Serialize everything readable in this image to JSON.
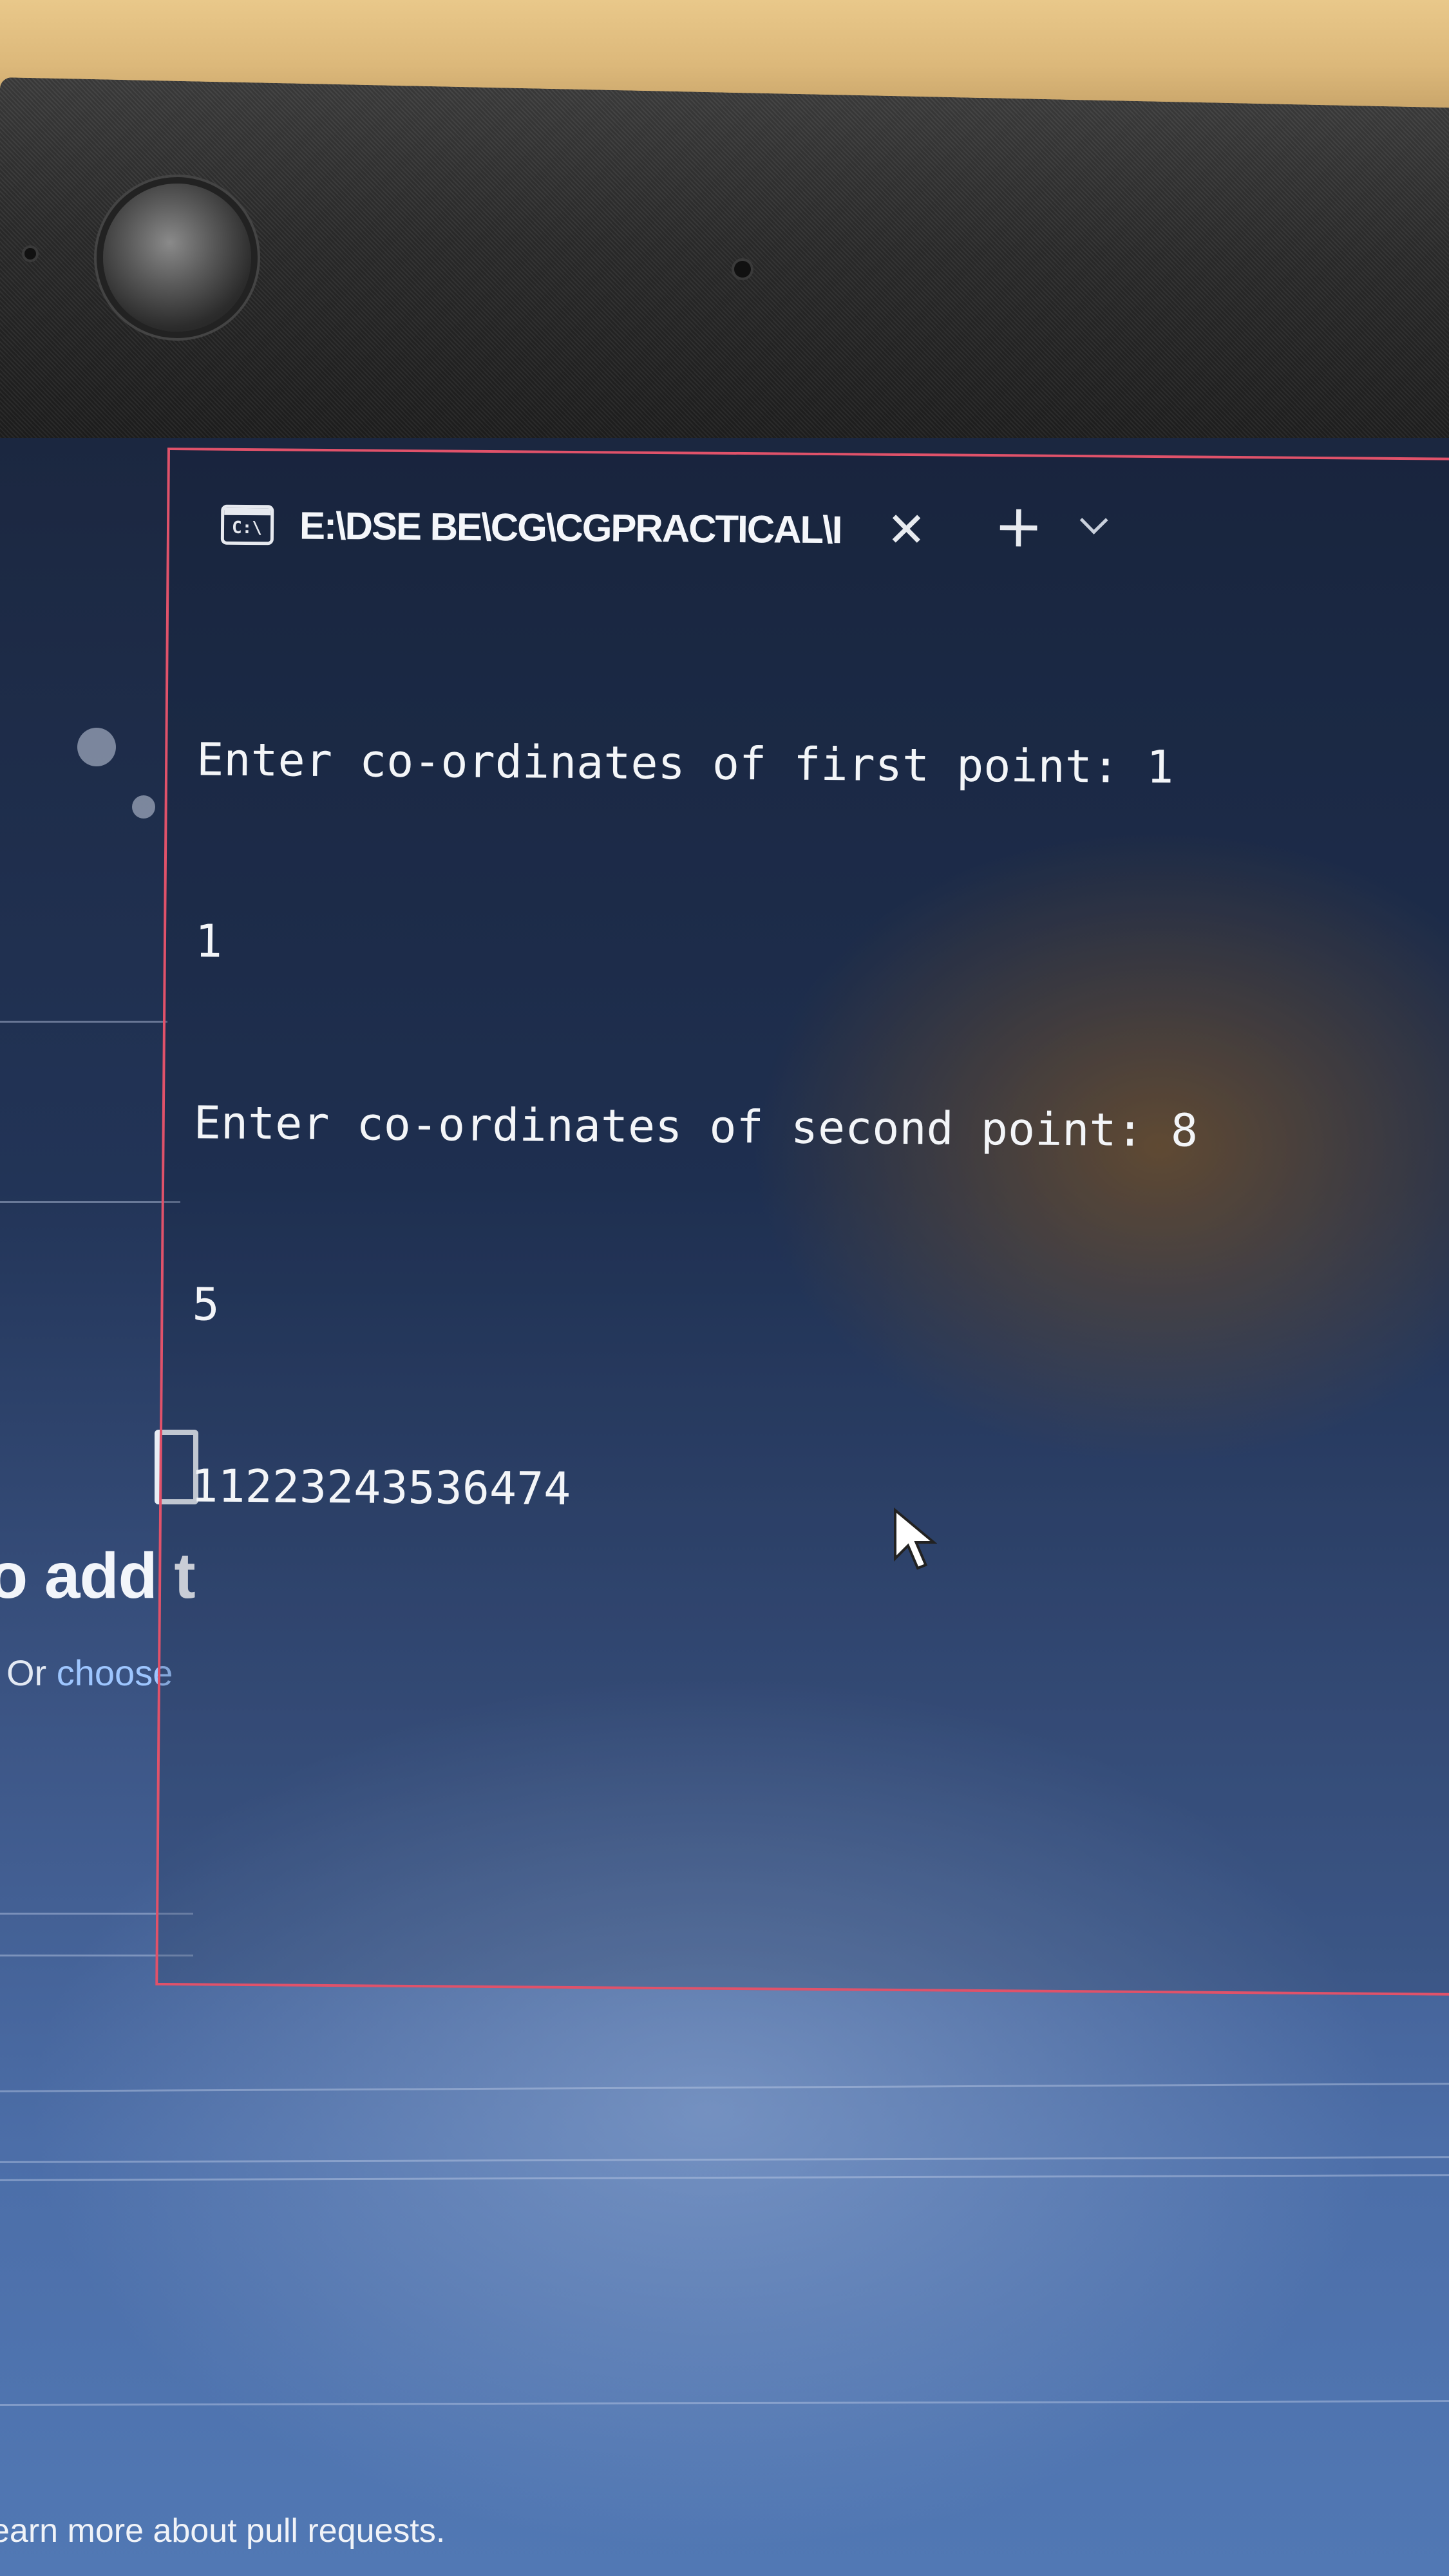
{
  "terminal": {
    "tab_title": "E:\\DSE BE\\CG\\CGPRACTICAL\\I",
    "tab_icon_text": "C:\\",
    "close_glyph": "✕",
    "new_tab_glyph": "+",
    "lines": [
      "Enter co-ordinates of first point: 1",
      "1",
      "Enter co-ordinates of second point: 8",
      "5",
      "11223243536474"
    ]
  },
  "background_page": {
    "heading_fragment": "o add t",
    "or_prefix": "Or ",
    "choose_link": "choose",
    "learn_more": "earn more about pull requests."
  },
  "colors": {
    "terminal_border": "#e0526a",
    "terminal_text": "#f3f5f8",
    "link": "#9ec6ff"
  }
}
